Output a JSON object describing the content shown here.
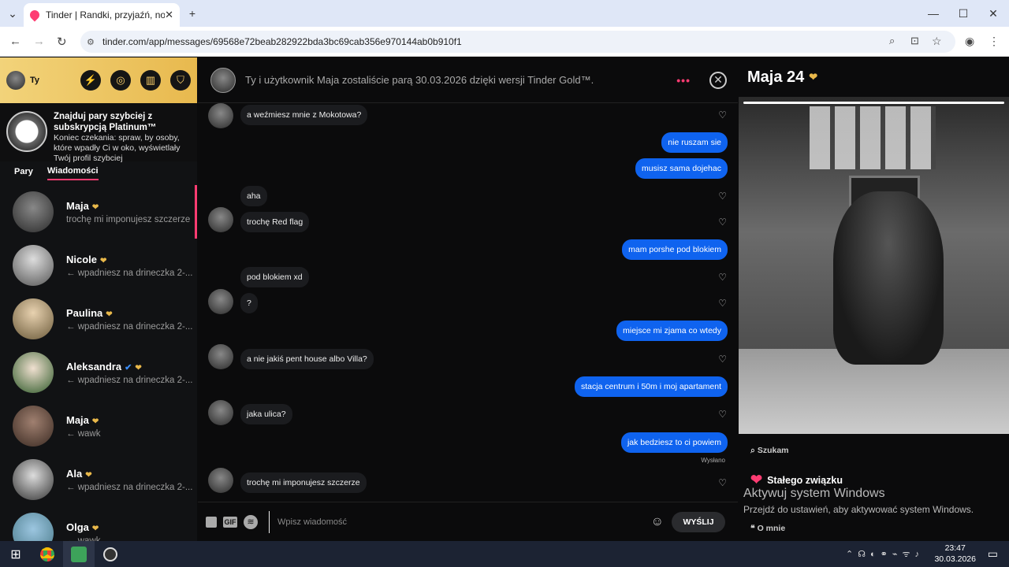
{
  "browser": {
    "tab_title": "Tinder | Randki, przyjaźń, nowe",
    "url": "tinder.com/app/messages/69568e72beab282922bda3bc69cab356e970144ab0b910f1"
  },
  "sidebar": {
    "user_label": "Ty",
    "promo_title": "Znajduj pary szybciej z subskrypcją Platinum™",
    "promo_text": "Koniec czekania: spraw, by osoby, które wpadły Ci w oko, wyświetlały Twój profil szybciej",
    "tabs": [
      {
        "label": "Pary"
      },
      {
        "label": "Wiadomości"
      }
    ],
    "matches": [
      {
        "name": "Maja",
        "preview": "trochę mi imponujesz szczerze"
      },
      {
        "name": "Nicole",
        "preview": "← wpadniesz na drineczka 2-..."
      },
      {
        "name": "Paulina",
        "preview": "← wpadniesz na drineczka 2-..."
      },
      {
        "name": "Aleksandra",
        "preview": "← wpadniesz na drineczka 2-..."
      },
      {
        "name": "Maja",
        "preview": "← wawk"
      },
      {
        "name": "Ala",
        "preview": "← wpadniesz na drineczka 2-..."
      },
      {
        "name": "Olga",
        "preview": "← wawk"
      }
    ]
  },
  "chat": {
    "header_text": "Ty i użytkownik Maja zostaliście parą 30.03.2026 dzięki wersji Tinder Gold™.",
    "messages": [
      {
        "text": "a weźmiesz mnie z Mokotowa?",
        "dir": "in"
      },
      {
        "text": "nie ruszam sie",
        "dir": "out"
      },
      {
        "text": "musisz sama dojehac",
        "dir": "out"
      },
      {
        "text": "aha",
        "dir": "in"
      },
      {
        "text": "trochę Red flag",
        "dir": "in"
      },
      {
        "text": "mam porshe pod blokiem",
        "dir": "out"
      },
      {
        "text": "pod blokiem xd",
        "dir": "in"
      },
      {
        "text": "?",
        "dir": "in"
      },
      {
        "text": "miejsce mi zjama co wtedy",
        "dir": "out"
      },
      {
        "text": "a nie jakiś pent house albo Villa?",
        "dir": "in"
      },
      {
        "text": "stacja centrum i 50m i moj apartament",
        "dir": "out"
      },
      {
        "text": "jaka ulica?",
        "dir": "in"
      },
      {
        "text": "jak bedziesz to ci powiem",
        "dir": "out"
      },
      {
        "text": "trochę mi imponujesz szczerze",
        "dir": "in"
      }
    ],
    "sent_label": "Wysłano",
    "input_placeholder": "Wpisz wiadomość",
    "gif_label": "GIF",
    "send_label": "WYŚLIJ"
  },
  "profile": {
    "name_age": "Maja 24",
    "looking_label": "Szukam",
    "looking_value": "Stałego związku",
    "about_label": "O mnie"
  },
  "windows": {
    "watermark_title": "Aktywuj system Windows",
    "watermark_text": "Przejdź do ustawień, aby aktywować system Windows.",
    "time": "23:47",
    "date": "30.03.2026"
  }
}
